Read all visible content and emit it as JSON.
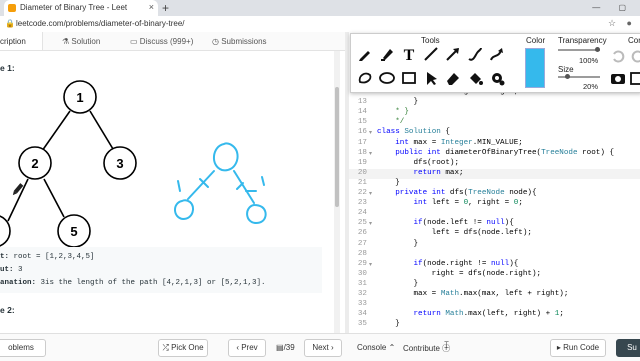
{
  "browser": {
    "tab_title": "Diameter of Binary Tree - Leet",
    "tab_close": "×",
    "new_tab": "+",
    "url": "leetcode.com/problems/diameter-of-binary-tree/",
    "window_controls": "— ▢"
  },
  "page_tabs": {
    "description": "cription",
    "solution": "Solution",
    "discuss": "Discuss (999+)",
    "submissions": "Submissions"
  },
  "description": {
    "example1_title": "e 1:",
    "example2_title": "e 2:",
    "tree_nodes": [
      "1",
      "2",
      "3",
      "5"
    ],
    "input_label": "t:",
    "input_value": " root = [1,2,3,4,5]",
    "output_label": "ut:",
    "output_value": " 3",
    "explanation_label": "anation:",
    "explanation_value": " 3is the length of the path [4,2,1,3] or [5,2,1,3]."
  },
  "toolbar": {
    "tools_title": "Tools",
    "color_title": "Color",
    "transparency_title": "Transparency",
    "transparency_value": "100%",
    "transparency_level": 1.0,
    "size_title": "Size",
    "size_value": "20%",
    "size_level": 0.2,
    "corner_title": "Corn",
    "color_hex": "#35b9ec",
    "tool_icons": [
      "pen-icon",
      "marker-icon",
      "text-icon",
      "line-icon",
      "arrow-icon",
      "curve-icon",
      "curved-arrow-icon",
      "lasso-icon",
      "ellipse-icon",
      "rectangle-icon",
      "pointer-icon",
      "eraser-icon",
      "fill-icon",
      "settings-icon"
    ]
  },
  "editor": {
    "lines": [
      {
        "n": "12",
        "t": "            this.right = right;"
      },
      {
        "n": "13",
        "t": "        }"
      },
      {
        "n": "14",
        "t": "    * }"
      },
      {
        "n": "15",
        "t": "    */"
      },
      {
        "n": "16",
        "t": "class Solution {",
        "fold": true
      },
      {
        "n": "17",
        "t": "    int max = Integer.MIN_VALUE;"
      },
      {
        "n": "18",
        "t": "    public int diameterOfBinaryTree(TreeNode root) {",
        "fold": true
      },
      {
        "n": "19",
        "t": "        dfs(root);"
      },
      {
        "n": "20",
        "t": "        return max;"
      },
      {
        "n": "21",
        "t": "    }"
      },
      {
        "n": "22",
        "t": "    private int dfs(TreeNode node){",
        "fold": true
      },
      {
        "n": "23",
        "t": "        int left = 0, right = 0;"
      },
      {
        "n": "24",
        "t": ""
      },
      {
        "n": "25",
        "t": "        if(node.left != null){",
        "fold": true
      },
      {
        "n": "26",
        "t": "            left = dfs(node.left);"
      },
      {
        "n": "27",
        "t": "        }"
      },
      {
        "n": "28",
        "t": ""
      },
      {
        "n": "29",
        "t": "        if(node.right != null){",
        "fold": true
      },
      {
        "n": "30",
        "t": "            right = dfs(node.right);"
      },
      {
        "n": "31",
        "t": "        }"
      },
      {
        "n": "32",
        "t": "        max = Math.max(max, left + right);"
      },
      {
        "n": "33",
        "t": ""
      },
      {
        "n": "34",
        "t": "        return Math.max(left, right) + 1;"
      },
      {
        "n": "35",
        "t": "    }"
      }
    ]
  },
  "footer": {
    "problems": "oblems",
    "pick_one": "Pick One",
    "prev": "Prev",
    "page_count": "/39",
    "next": "Next",
    "console": "Console",
    "contribute": "Contribute",
    "run_code": "Run Code",
    "submit": "Su"
  }
}
